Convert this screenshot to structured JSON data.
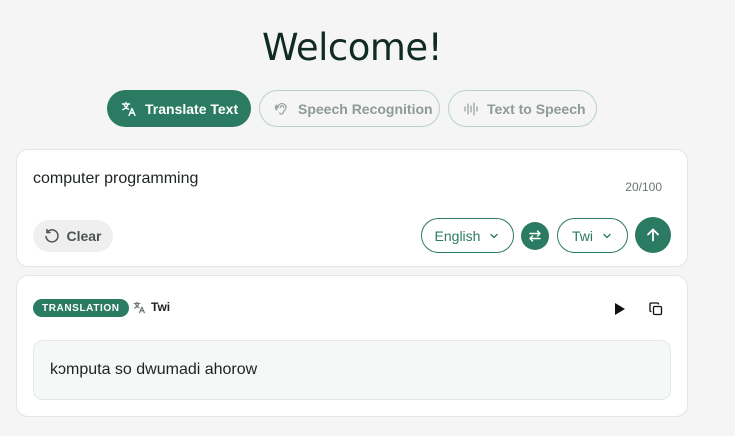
{
  "header": {
    "title": "Welcome!"
  },
  "tabs": [
    {
      "label": "Translate Text",
      "active": true,
      "icon": "translate-icon"
    },
    {
      "label": "Speech Recognition",
      "active": false,
      "icon": "ear-icon"
    },
    {
      "label": "Text to Speech",
      "active": false,
      "icon": "waveform-icon"
    }
  ],
  "input": {
    "text": "computer programming",
    "char_count": "20/100",
    "clear_label": "Clear",
    "source_language": "English",
    "target_language": "Twi"
  },
  "output": {
    "badge": "TRANSLATION",
    "language": "Twi",
    "text": "kɔmputa so dwumadi ahorow"
  },
  "colors": {
    "accent": "#2b7a62",
    "background": "#f5f5f5",
    "card": "#ffffff"
  }
}
